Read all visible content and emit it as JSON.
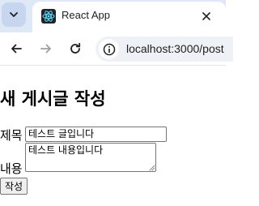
{
  "browser": {
    "tab": {
      "title": "React App",
      "favicon": "react-logo-icon"
    },
    "url": "localhost:3000/post"
  },
  "page": {
    "title": "새 게시글 작성",
    "form": {
      "title_label": "제목",
      "title_value": "테스트 글입니다",
      "content_label": "내용",
      "content_value": "테스트 내용입니다",
      "submit_label": "작성"
    }
  },
  "colors": {
    "tabstrip": "#dfe8f7",
    "react_logo": "#61dafb"
  }
}
